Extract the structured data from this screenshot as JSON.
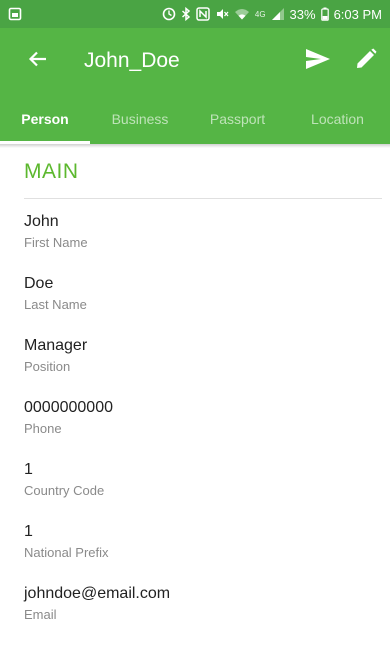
{
  "status_bar": {
    "right_text": "33%",
    "time": "6:03 PM",
    "network_label": "4G"
  },
  "app_bar": {
    "title": "John_Doe"
  },
  "tabs": [
    {
      "label": "Person",
      "active": true
    },
    {
      "label": "Business",
      "active": false
    },
    {
      "label": "Passport",
      "active": false
    },
    {
      "label": "Location",
      "active": false
    }
  ],
  "section": {
    "title": "MAIN"
  },
  "fields": [
    {
      "value": "John",
      "label": "First Name"
    },
    {
      "value": "Doe",
      "label": "Last Name"
    },
    {
      "value": "Manager",
      "label": "Position"
    },
    {
      "value": "0000000000",
      "label": "Phone"
    },
    {
      "value": "1",
      "label": "Country Code"
    },
    {
      "value": "1",
      "label": "National Prefix"
    },
    {
      "value": "johndoe@email.com",
      "label": "Email"
    }
  ],
  "colors": {
    "status_bar": "#4aa444",
    "app_bar": "#55b545",
    "accent": "#5cb82e"
  },
  "icons": {
    "status": [
      "screenshot-icon",
      "sync-icon",
      "bluetooth-icon",
      "nfc-icon",
      "mute-icon",
      "wifi-icon",
      "signal-icon",
      "battery-icon"
    ],
    "app_bar": [
      "back-arrow-icon",
      "send-icon",
      "edit-icon"
    ]
  }
}
